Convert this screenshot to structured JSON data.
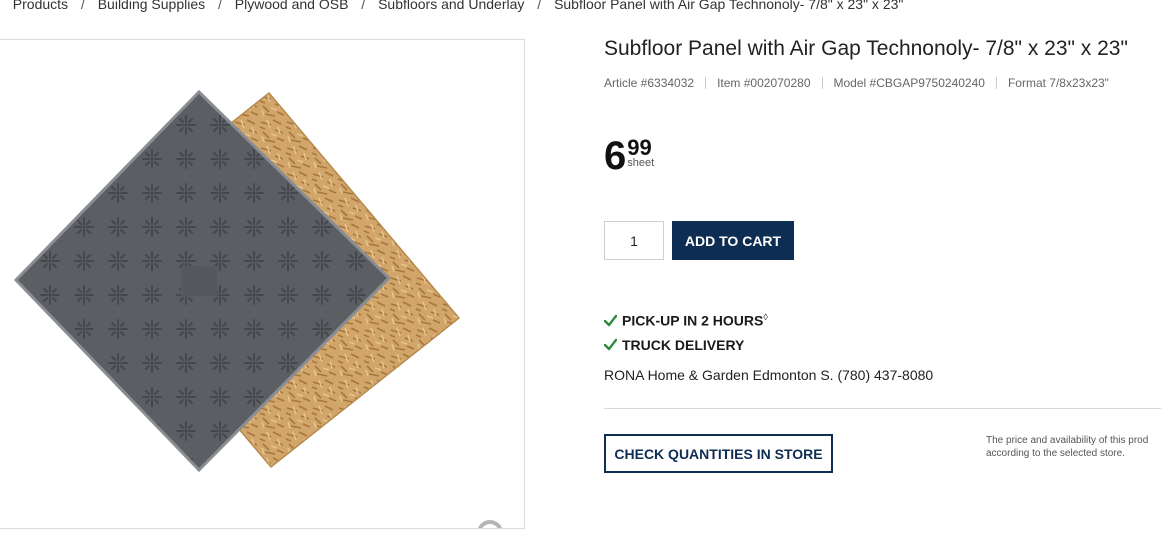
{
  "breadcrumb": {
    "items": [
      "Products",
      "Building Supplies",
      "Plywood and OSB",
      "Subfloors and Underlay",
      "Subfloor Panel with Air Gap Technonoly- 7/8\" x 23\" x 23\""
    ],
    "separator": "/"
  },
  "product": {
    "title": "Subfloor Panel with Air Gap Technonoly- 7/8\" x 23\" x 23\"",
    "article": "Article #6334032",
    "item": "Item #002070280",
    "model": "Model #CBGAP9750240240",
    "format": "Format 7/8x23x23\"",
    "image_icon": "subfloor-panel-image",
    "zoom_icon": "magnifier-icon"
  },
  "price": {
    "dollars": "6",
    "cents": "99",
    "unit": "sheet"
  },
  "cart": {
    "quantity": "1",
    "add_label": "ADD TO CART"
  },
  "fulfillment": {
    "pickup_label": "PICK-UP IN 2 HOURS",
    "pickup_mark": "◊",
    "delivery_label": "TRUCK DELIVERY",
    "store": "RONA Home & Garden Edmonton S. (780) 437-8080",
    "check_icon": "checkmark-icon"
  },
  "store_check": {
    "button_label": "CHECK QUANTITIES IN STORE",
    "disclaimer_line1": "The price and availability of this prod",
    "disclaimer_line2": "according to the selected store."
  },
  "colors": {
    "brand_navy": "#0e2d52",
    "check_green": "#2e8b3d",
    "panel_gray": "#5b5e63",
    "osb_tan": "#c99a5e"
  }
}
